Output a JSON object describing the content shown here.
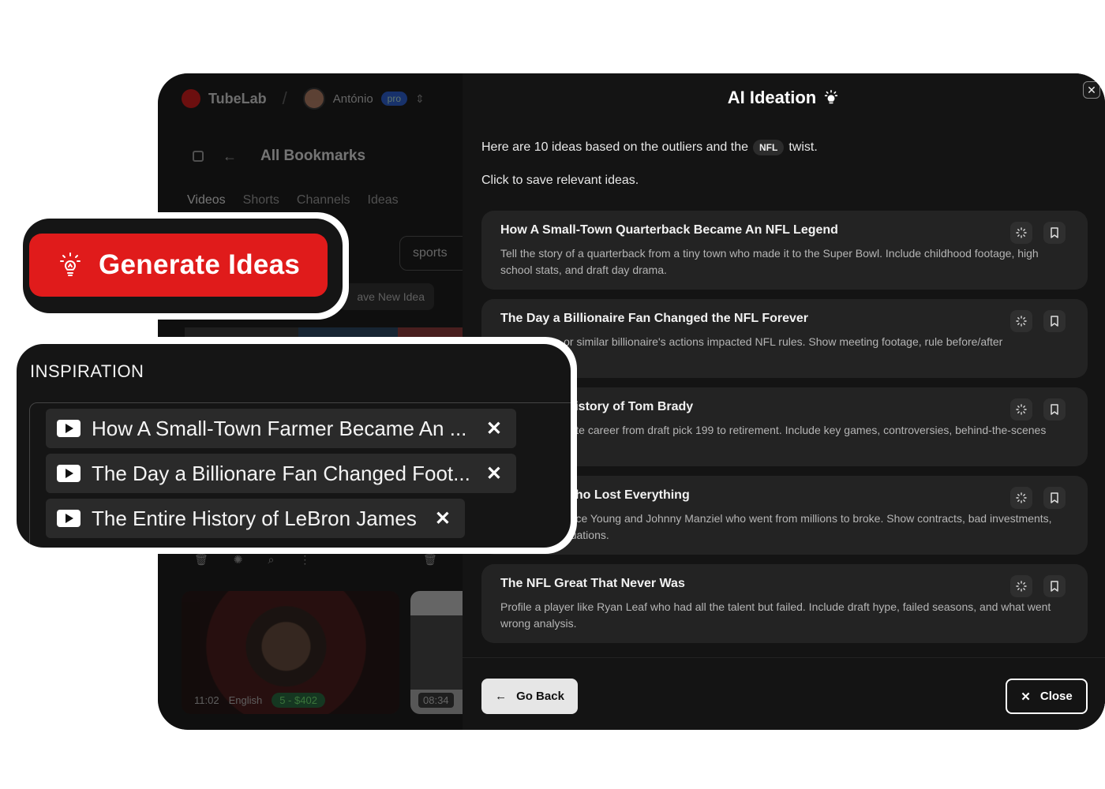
{
  "background_app": {
    "logo_text": "TubeLab",
    "user_name": "António",
    "plan_badge": "pro",
    "page_title": "All Bookmarks",
    "tabs": [
      "Videos",
      "Shorts",
      "Channels",
      "Ideas"
    ],
    "filter_chip": "sports",
    "save_new_idea_label": "ave New Idea",
    "video1": {
      "duration": "11:02",
      "language": "English",
      "price": "5 - $402"
    },
    "video2": {
      "duration": "08:34"
    }
  },
  "modal": {
    "title": "AI Ideation",
    "intro_prefix": "Here are 10 ideas based on the outliers and the",
    "intro_chip": "NFL",
    "intro_suffix": "twist.",
    "intro_line2": "Click to save relevant ideas.",
    "ideas": [
      {
        "title": "How A Small-Town Quarterback Became An NFL Legend",
        "description": "Tell the story of a quarterback from a tiny town who made it to the Super Bowl. Include childhood footage, high school stats, and draft day drama."
      },
      {
        "title": "The Day a Billionaire Fan Changed the NFL Forever",
        "description": "Mark Cuban or similar billionaire's actions impacted NFL rules. Show meeting footage, rule before/after comparisons."
      },
      {
        "title": "The Entire History of Tom Brady",
        "description": "Brady's complete career from draft pick 199 to retirement. Include key games, controversies, behind-the-scenes moments."
      },
      {
        "title": "NFL Stars Who Lost Everything",
        "description": "Players like Vince Young and Johnny Manziel who went from millions to broke. Show contracts, bad investments, and current situations."
      },
      {
        "title": "The NFL Great That Never Was",
        "description": "Profile a player like Ryan Leaf who had all the talent but failed. Include draft hype, failed seasons, and what went wrong analysis."
      }
    ],
    "go_back_label": "Go Back",
    "close_label": "Close"
  },
  "callout_generate": {
    "label": "Generate Ideas"
  },
  "callout_inspiration": {
    "heading": "INSPIRATION",
    "items": [
      "How A Small-Town Farmer Became An ...",
      "The Day a Billionare Fan Changed Foot...",
      "The Entire History of LeBron James"
    ]
  },
  "colors": {
    "accent_red": "#e01b1b",
    "modal_bg": "#141414",
    "card_bg": "#232323"
  }
}
